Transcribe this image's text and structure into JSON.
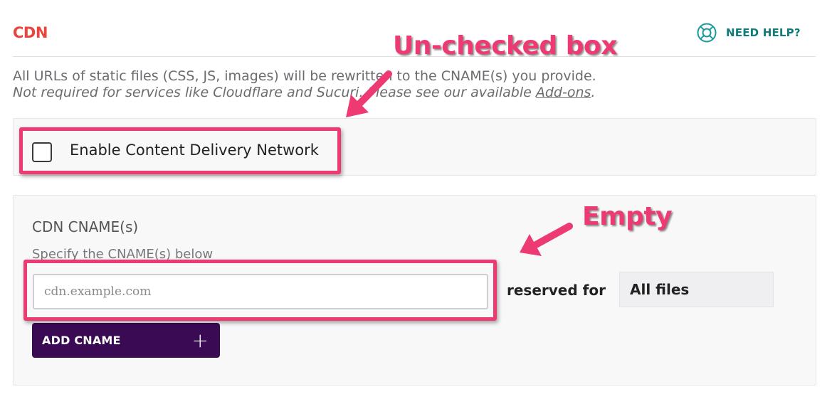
{
  "header": {
    "title": "CDN",
    "help_label": "NEED HELP?"
  },
  "description": {
    "line1": "All URLs of static files (CSS, JS, images) will be rewritten to the CNAME(s) you provide.",
    "line2_prefix": "Not required for services like Cloudflare and Sucuri. Please see our available ",
    "line2_link": "Add-ons",
    "line2_suffix": "."
  },
  "cdn_toggle": {
    "label": "Enable Content Delivery Network",
    "checked": false
  },
  "cname": {
    "title": "CDN CNAME(s)",
    "subtitle": "Specify the CNAME(s) below",
    "input_value": "",
    "input_placeholder": "cdn.example.com",
    "reserved_label": "reserved for",
    "reserved_value": "All files",
    "add_button_label": "ADD CNAME",
    "add_button_icon": "+"
  },
  "annotations": {
    "checkbox_note": "Un-checked box",
    "input_note": "Empty",
    "color": "#ee3a72"
  },
  "colors": {
    "title": "#e8453c",
    "help": "#117a7a",
    "button": "#3b0a54"
  },
  "icons": {
    "help": "lifebuoy-icon"
  }
}
